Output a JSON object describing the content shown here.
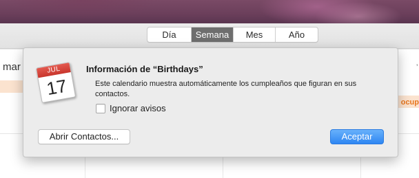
{
  "toolbar": {
    "views": [
      {
        "label": "Día",
        "active": false
      },
      {
        "label": "Semana",
        "active": true
      },
      {
        "label": "Mes",
        "active": false
      },
      {
        "label": "Año",
        "active": false
      }
    ]
  },
  "background": {
    "day_label_fragment": "mar",
    "busy_label_fragment": ": ocup",
    "busy_color": "#e8771f"
  },
  "popover": {
    "icon": {
      "name": "calendar-icon",
      "month": "JUL",
      "day": "17"
    },
    "title": "Información de “Birthdays”",
    "description": "Este calendario muestra automáticamente los cumpleaños que figuran en sus contactos.",
    "ignore_alerts": {
      "label": "Ignorar avisos",
      "checked": false
    },
    "open_contacts_label": "Abrir Contactos...",
    "accept_label": "Aceptar",
    "accent_color": "#2e86f2"
  }
}
